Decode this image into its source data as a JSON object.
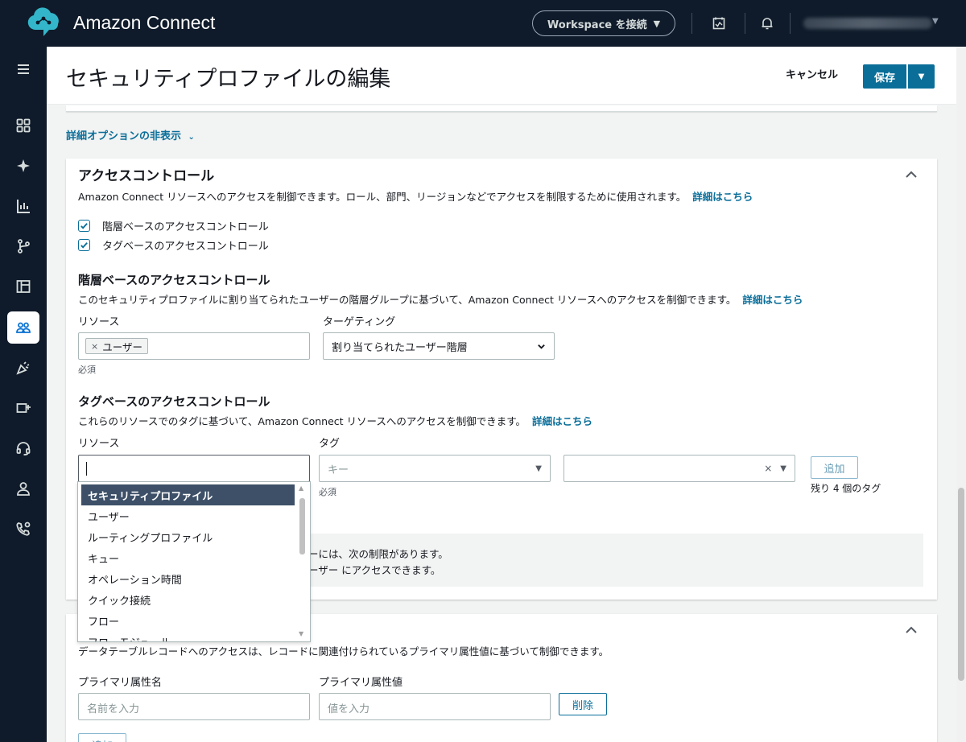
{
  "topbar": {
    "app_title": "Amazon Connect",
    "workspace_button": "Workspace を接続",
    "user_label": ""
  },
  "sidebar": {
    "items": [
      {
        "name": "menu-icon"
      },
      {
        "name": "dashboard-icon"
      },
      {
        "name": "sparkle-icon"
      },
      {
        "name": "analytics-icon"
      },
      {
        "name": "routing-icon"
      },
      {
        "name": "layout-icon"
      },
      {
        "name": "users-icon",
        "active": true
      },
      {
        "name": "campaign-icon"
      },
      {
        "name": "channels-icon"
      },
      {
        "name": "headset-icon"
      },
      {
        "name": "customer-profile-icon"
      },
      {
        "name": "phone-settings-icon"
      }
    ]
  },
  "header": {
    "title": "セキュリティプロファイルの編集",
    "cancel_label": "キャンセル",
    "save_label": "保存"
  },
  "main": {
    "hide_options_link": "詳細オプションの非表示",
    "access_control": {
      "title": "アクセスコントロール",
      "description": "Amazon Connect リソースへのアクセスを制御できます。ロール、部門、リージョンなどでアクセスを制限するために使用されます。",
      "learn_more": "詳細はこちら",
      "checkboxes": [
        {
          "label": "階層ベースのアクセスコントロール",
          "checked": true
        },
        {
          "label": "タグベースのアクセスコントロール",
          "checked": true
        }
      ],
      "hierarchy": {
        "title": "階層ベースのアクセスコントロール",
        "description": "このセキュリティプロファイルに割り当てられたユーザーの階層グループに基づいて、Amazon Connect リソースへのアクセスを制御できます。",
        "learn_more": "詳細はこちら",
        "resource_label": "リソース",
        "resource_chip": "ユーザー",
        "required_hint": "必須",
        "targeting_label": "ターゲティング",
        "targeting_value": "割り当てられたユーザー階層"
      },
      "tag": {
        "title": "タグベースのアクセスコントロール",
        "description": "これらのリソースでのタグに基づいて、Amazon Connect リソースへのアクセスを制御できます。",
        "learn_more": "詳細はこちら",
        "resource_label": "リソース",
        "tag_label": "タグ",
        "key_placeholder": "キー",
        "required_hint": "必須",
        "add_button": "追加",
        "remaining_tags": "残り 4 個のタグ"
      },
      "info": {
        "line1": "ーには、次の制限があります。",
        "line2": "ーザー にアクセスできます。"
      }
    },
    "datatable": {
      "description": "データテーブルレコードへのアクセスは、レコードに関連付けられているプライマリ属性値に基づいて制御できます。",
      "attr_name_label": "プライマリ属性名",
      "attr_name_placeholder": "名前を入力",
      "attr_value_label": "プライマリ属性値",
      "attr_value_placeholder": "値を入力",
      "delete_button": "削除",
      "add_button": "追加"
    }
  },
  "dropdown": {
    "options": [
      "セキュリティプロファイル",
      "ユーザー",
      "ルーティングプロファイル",
      "キュー",
      "オペレーション時間",
      "クイック接続",
      "フロー",
      "フローモジュール"
    ],
    "selected_index": 0
  },
  "colors": {
    "nav_bg": "#0f1b2a",
    "primary": "#0a6e99",
    "selected_option": "#3d5068"
  }
}
